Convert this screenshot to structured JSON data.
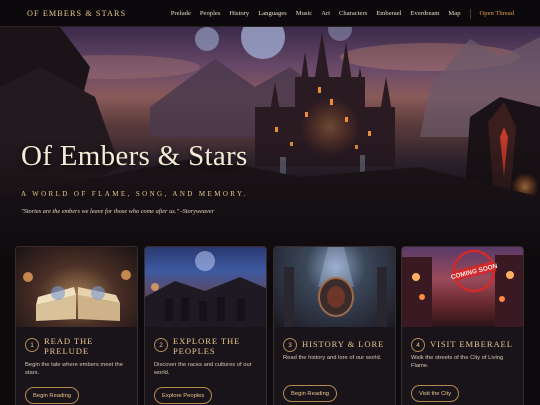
{
  "nav": {
    "brand": "OF EMBERS & STARS",
    "items": [
      "Prelude",
      "Peoples",
      "History",
      "Languages",
      "Music",
      "Art",
      "Characters",
      "Emberael",
      "Everdream",
      "Map"
    ],
    "cta": "Open Thread"
  },
  "hero": {
    "title": "Of Embers & Stars",
    "subtitle": "A WORLD OF FLAME, SONG, AND MEMORY.",
    "quote": "\"Stories are the embers we leave for those who come after us.\" -Storyweaver"
  },
  "cards": [
    {
      "num": "1",
      "title": "READ THE PRELUDE",
      "desc": "Begin the tale where embers meet the stars.",
      "button": "Begin Reading",
      "image": "open-book-image"
    },
    {
      "num": "2",
      "title": "EXPLORE THE PEOPLES",
      "desc": "Discover the races and cultures of our world.",
      "button": "Explore Peoples",
      "image": "peoples-gathering-image"
    },
    {
      "num": "3",
      "title": "HISTORY & LORE",
      "desc": "Read the history and lore of our world.",
      "button": "Begin Reading",
      "image": "ancient-portal-image"
    },
    {
      "num": "4",
      "title": "VISIT EMBERAEL",
      "desc": "Walk the streets of the City of Living Flame.",
      "button": "Visit the City",
      "image": "city-street-image",
      "stamp": "COMING SOON"
    }
  ],
  "colors": {
    "accent": "#e9c58c",
    "cta": "#e09a4a",
    "background": "#0d0a0d"
  }
}
